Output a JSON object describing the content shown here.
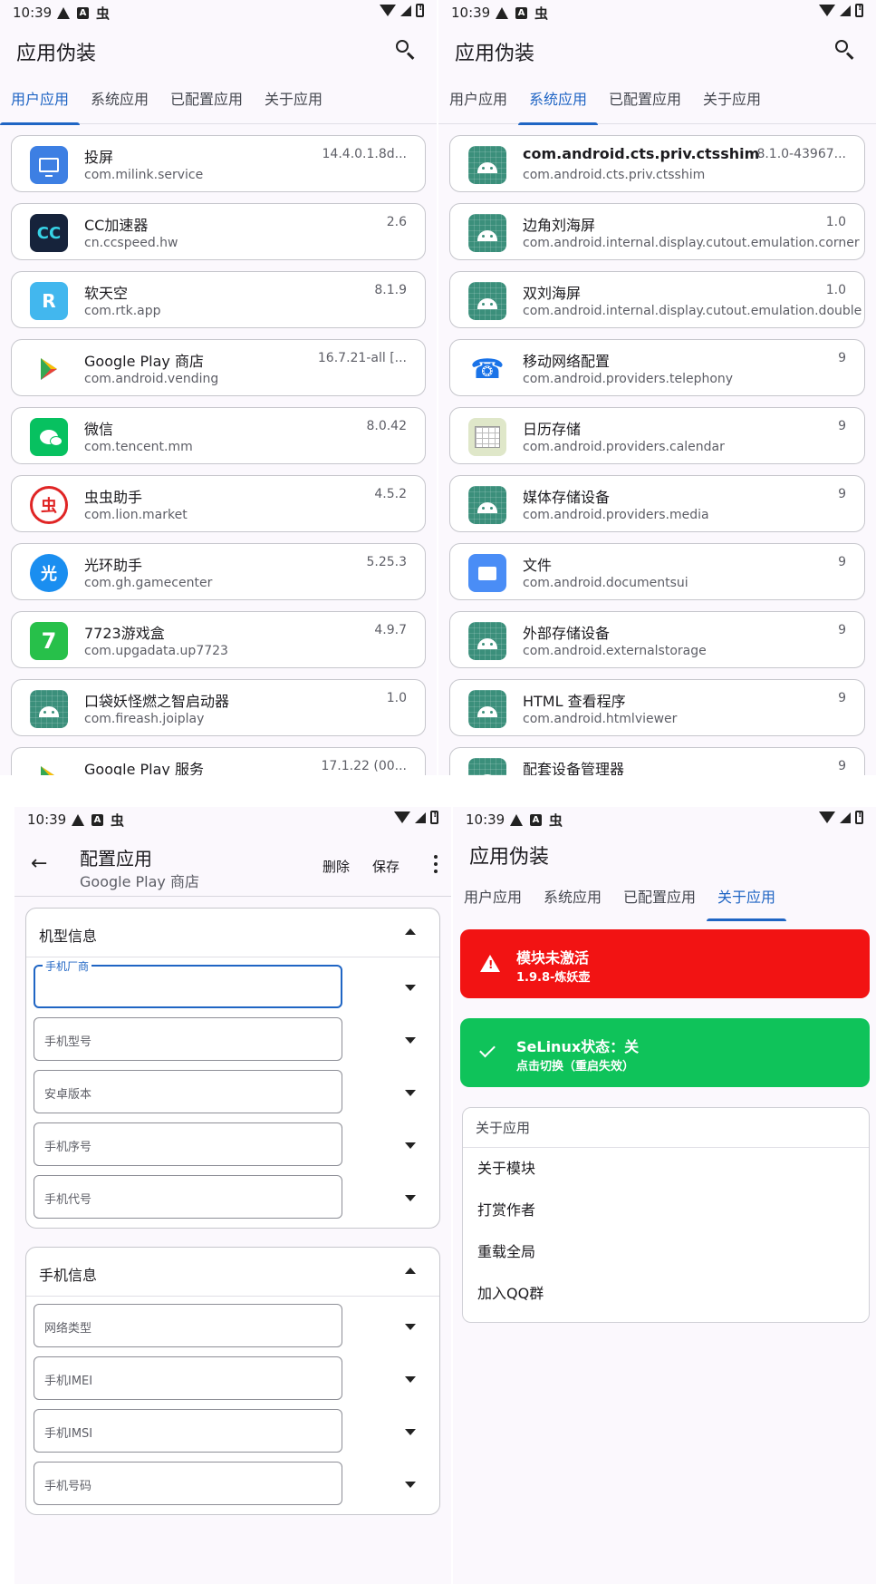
{
  "status": {
    "time": "10:39"
  },
  "main": {
    "title": "应用伪装",
    "tabs": [
      "用户应用",
      "系统应用",
      "已配置应用",
      "关于应用"
    ]
  },
  "user_apps": [
    {
      "name": "投屏",
      "pkg": "com.milink.service",
      "ver": "14.4.0.1.8d...",
      "icon": "cast-screen-icon",
      "color": "#3d7fe3"
    },
    {
      "name": "CC加速器",
      "pkg": "cn.ccspeed.hw",
      "ver": "2.6",
      "icon": "cc-accelerator-icon",
      "color": "#16233b"
    },
    {
      "name": "软天空",
      "pkg": "com.rtk.app",
      "ver": "8.1.9",
      "icon": "rtk-bag-icon",
      "color": "#42b7ee"
    },
    {
      "name": "Google Play 商店",
      "pkg": "com.android.vending",
      "ver": "16.7.21-all [...",
      "icon": "play-store-icon",
      "color": "#ffffff"
    },
    {
      "name": "微信",
      "pkg": "com.tencent.mm",
      "ver": "8.0.42",
      "icon": "wechat-icon",
      "color": "#07c160"
    },
    {
      "name": "虫虫助手",
      "pkg": "com.lion.market",
      "ver": "4.5.2",
      "icon": "chongchong-icon",
      "color": "#e02525"
    },
    {
      "name": "光环助手",
      "pkg": "com.gh.gamecenter",
      "ver": "5.25.3",
      "icon": "guanghuan-icon",
      "color": "#1a8ef0"
    },
    {
      "name": "7723游戏盒",
      "pkg": "com.upgadata.up7723",
      "ver": "4.9.7",
      "icon": "7723-icon",
      "color": "#27c04a"
    },
    {
      "name": "口袋妖怪燃之智启动器",
      "pkg": "com.fireash.joiplay",
      "ver": "1.0",
      "icon": "android-icon",
      "color": "#3ddc84"
    },
    {
      "name": "Google Play 服务",
      "pkg": "",
      "ver": "17.1.22 (00...",
      "icon": "play-services-icon",
      "color": "#ffffff"
    }
  ],
  "system_apps": [
    {
      "name": "com.android.cts.priv.ctsshim",
      "pkg": "com.android.cts.priv.ctsshim",
      "ver": "8.1.0-43967...",
      "icon": "android-icon",
      "bold": true
    },
    {
      "name": "边角刘海屏",
      "pkg": "com.android.internal.display.cutout.emulation.corner",
      "ver": "1.0",
      "icon": "android-icon"
    },
    {
      "name": "双刘海屏",
      "pkg": "com.android.internal.display.cutout.emulation.double",
      "ver": "1.0",
      "icon": "android-icon"
    },
    {
      "name": "移动网络配置",
      "pkg": "com.android.providers.telephony",
      "ver": "9",
      "icon": "phone-icon"
    },
    {
      "name": "日历存储",
      "pkg": "com.android.providers.calendar",
      "ver": "9",
      "icon": "calendar-icon"
    },
    {
      "name": "媒体存储设备",
      "pkg": "com.android.providers.media",
      "ver": "9",
      "icon": "android-icon"
    },
    {
      "name": "文件",
      "pkg": "com.android.documentsui",
      "ver": "9",
      "icon": "folder-icon"
    },
    {
      "name": "外部存储设备",
      "pkg": "com.android.externalstorage",
      "ver": "9",
      "icon": "android-icon"
    },
    {
      "name": "HTML 查看程序",
      "pkg": "com.android.htmlviewer",
      "ver": "9",
      "icon": "android-icon"
    },
    {
      "name": "配套设备管理器",
      "pkg": "",
      "ver": "9",
      "icon": "android-icon"
    }
  ],
  "config": {
    "title": "配置应用",
    "subtitle": "Google Play 商店",
    "delete": "删除",
    "save": "保存",
    "group1": {
      "title": "机型信息",
      "fields": [
        "手机厂商",
        "手机型号",
        "安卓版本",
        "手机序号",
        "手机代号"
      ]
    },
    "group2": {
      "title": "手机信息",
      "fields": [
        "网络类型",
        "手机IMEI",
        "手机IMSI",
        "手机号码"
      ]
    }
  },
  "about": {
    "module_status": "模块未激活",
    "module_version": "1.9.8-炼妖壶",
    "selinux_status": "SeLinux状态：关",
    "selinux_hint": "点击切换（重启失效）",
    "section_title": "关于应用",
    "items": [
      "关于模块",
      "打赏作者",
      "重载全局",
      "加入QQ群"
    ]
  },
  "colors": {
    "accent": "#1f65c4",
    "danger": "#f21313",
    "success": "#0fc35a"
  }
}
